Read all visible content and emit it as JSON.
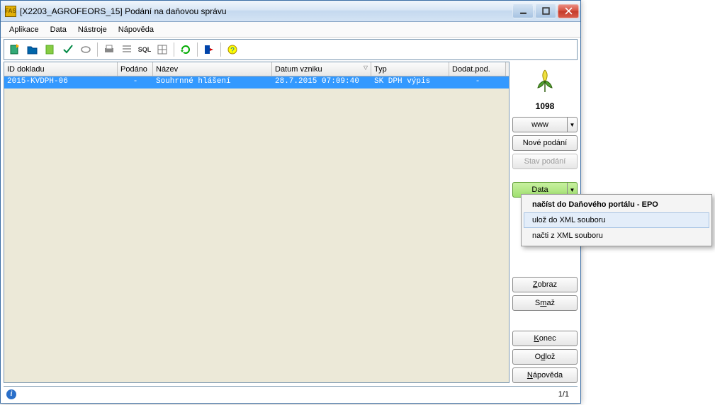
{
  "titlebar": {
    "icon_text": "FAS",
    "title": "[X2203_AGROFEORS_15] Podání na daňovou správu"
  },
  "menubar": {
    "items": [
      "Aplikace",
      "Data",
      "Nástroje",
      "Nápověda"
    ]
  },
  "table": {
    "headers": [
      "ID dokladu",
      "Podáno",
      "Název",
      "Datum vzniku",
      "Typ",
      "Dodat.pod."
    ],
    "rows": [
      {
        "id": "2015-KVDPH-06",
        "podano": "-",
        "nazev": "Souhrnné hlášení",
        "datum": "28.7.2015 07:09:40",
        "typ": "SK DPH výpis",
        "dodat": "-"
      }
    ]
  },
  "sidepanel": {
    "count": "1098",
    "www_label": "www",
    "nove_label": "Nové podání",
    "stav_label": "Stav podání",
    "data_label": "Data",
    "zobraz_label": "Zobraz",
    "smaz_label": "Smaž",
    "konec_label": "Konec",
    "odloz_label": "Odlož",
    "napoveda_label": "Nápověda"
  },
  "statusbar": {
    "page": "1/1"
  },
  "dropdown": {
    "items": [
      "načíst do Daňového portálu - EPO",
      "ulož do XML souboru",
      "načti z XML souboru"
    ]
  },
  "chart_data": null
}
